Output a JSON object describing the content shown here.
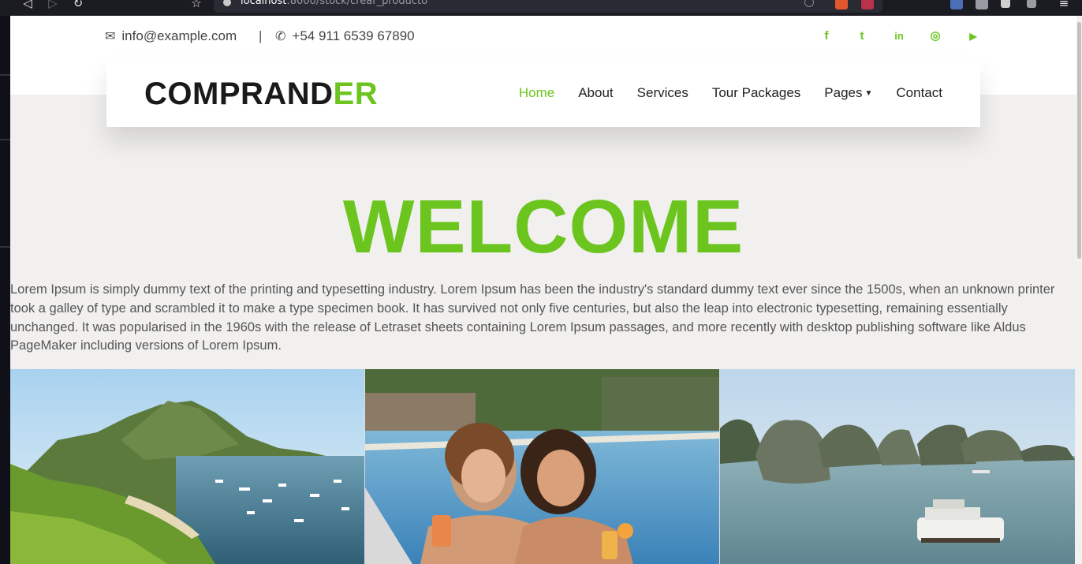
{
  "browser": {
    "url_host": "localhost",
    "url_path": ":8000/stock/crear_producto"
  },
  "topbar": {
    "email": "info@example.com",
    "separator": "|",
    "phone": "+54 911 6539 67890",
    "social": [
      {
        "name": "facebook-icon",
        "glyph": "f"
      },
      {
        "name": "twitter-icon",
        "glyph": "t"
      },
      {
        "name": "linkedin-icon",
        "glyph": "in"
      },
      {
        "name": "instagram-icon",
        "glyph": "◎"
      },
      {
        "name": "youtube-icon",
        "glyph": "▶"
      }
    ]
  },
  "brand": {
    "main": "COMPRAND",
    "accent": "ER"
  },
  "nav": {
    "items": [
      {
        "label": "Home",
        "active": true
      },
      {
        "label": "About",
        "active": false
      },
      {
        "label": "Services",
        "active": false
      },
      {
        "label": "Tour Packages",
        "active": false
      },
      {
        "label": "Pages",
        "active": false,
        "dropdown": true
      },
      {
        "label": "Contact",
        "active": false
      }
    ]
  },
  "hero": {
    "title": "WELCOME",
    "text": "Lorem Ipsum is simply dummy text of the printing and typesetting industry. Lorem Ipsum has been the industry's standard dummy text ever since the 1500s, when an unknown printer took a galley of type and scrambled it to make a type specimen book. It has survived not only five centuries, but also the leap into electronic typesetting, remaining essentially unchanged. It was popularised in the 1960s with the release of Letraset sheets containing Lorem Ipsum passages, and more recently with desktop publishing software like Aldus PageMaker including versions of Lorem Ipsum."
  },
  "colors": {
    "accent": "#6cc51f",
    "background": "#f1f0ef"
  },
  "gallery": [
    {
      "name": "gallery-image-island-bay"
    },
    {
      "name": "gallery-image-pool-women"
    },
    {
      "name": "gallery-image-halong-bay"
    }
  ]
}
